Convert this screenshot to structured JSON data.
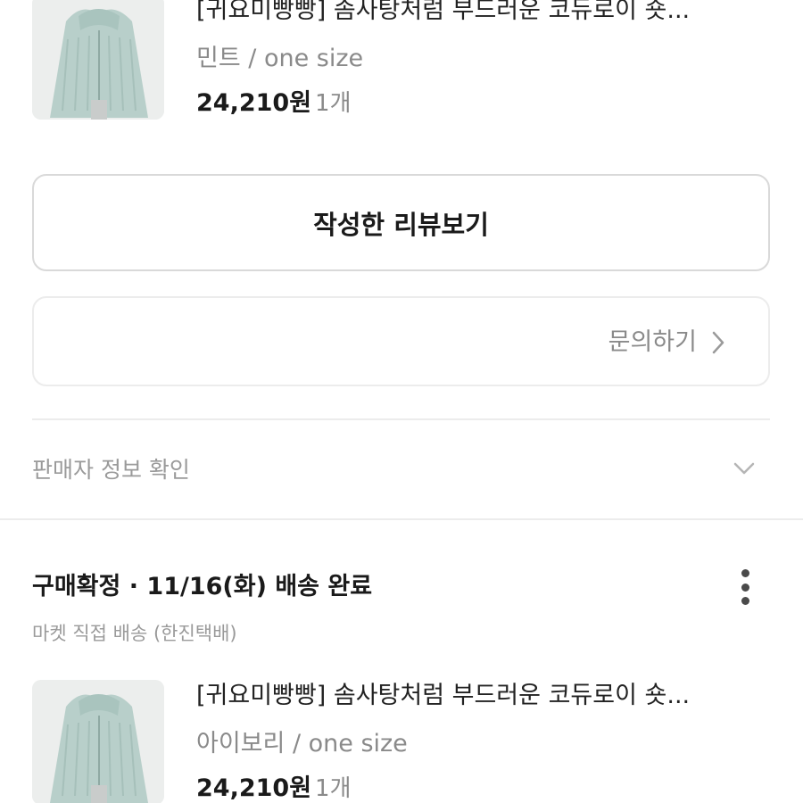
{
  "orders": [
    {
      "product": {
        "title": "[귀요미빵빵] 솜사탕처럼 부드러운 코듀로이 숏...",
        "option": "민트 / one size",
        "price": "24,210원",
        "quantity": "1개"
      }
    },
    {
      "status": "구매확정 · 11/16(화) 배송 완료",
      "shipping": "마켓 직접 배송 (한진택배)",
      "product": {
        "title": "[귀요미빵빵] 솜사탕처럼 부드러운 코듀로이 숏...",
        "option": "아이보리 / one size",
        "price": "24,210원",
        "quantity": "1개"
      }
    }
  ],
  "actions": {
    "review_label": "작성한 리뷰보기",
    "inquiry_label": "문의하기",
    "seller_info_label": "판매자 정보 확인"
  },
  "icons": {
    "inquiry": "chevron-right-icon",
    "seller_info": "chevron-down-icon",
    "order_menu": "more-vertical-icon"
  },
  "colors": {
    "text_primary": "#1a1a1a",
    "text_secondary": "#8a8a8a",
    "border": "#d9d9d9",
    "product_mint": "#b9d1cc"
  }
}
